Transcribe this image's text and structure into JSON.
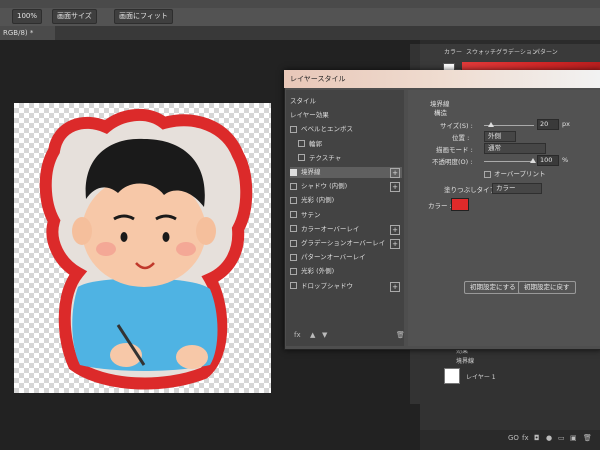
{
  "options_bar": {
    "zoom": "100%",
    "fit_screen": "画面サイズ",
    "fit_view": "画面にフィット"
  },
  "document": {
    "tab_title": "RGB/8) *"
  },
  "right_panel": {
    "tabs": [
      "カラー",
      "スウォッチ",
      "グラデーション",
      "パターン"
    ]
  },
  "dialog": {
    "title": "レイヤースタイル",
    "styles": [
      {
        "label": "スタイル",
        "checkbox": false,
        "checked": false,
        "plus": false,
        "active": false,
        "indent": false
      },
      {
        "label": "レイヤー効果",
        "checkbox": false,
        "checked": false,
        "plus": false,
        "active": false,
        "indent": false
      },
      {
        "label": "ベベルとエンボス",
        "checkbox": true,
        "checked": false,
        "plus": false,
        "active": false,
        "indent": false
      },
      {
        "label": "輪郭",
        "checkbox": true,
        "checked": false,
        "plus": false,
        "active": false,
        "indent": true
      },
      {
        "label": "テクスチャ",
        "checkbox": true,
        "checked": false,
        "plus": false,
        "active": false,
        "indent": true
      },
      {
        "label": "境界線",
        "checkbox": true,
        "checked": true,
        "plus": true,
        "active": true,
        "indent": false
      },
      {
        "label": "シャドウ (内側)",
        "checkbox": true,
        "checked": false,
        "plus": true,
        "active": false,
        "indent": false
      },
      {
        "label": "光彩 (内側)",
        "checkbox": true,
        "checked": false,
        "plus": false,
        "active": false,
        "indent": false
      },
      {
        "label": "サテン",
        "checkbox": true,
        "checked": false,
        "plus": false,
        "active": false,
        "indent": false
      },
      {
        "label": "カラーオーバーレイ",
        "checkbox": true,
        "checked": false,
        "plus": true,
        "active": false,
        "indent": false
      },
      {
        "label": "グラデーションオーバーレイ",
        "checkbox": true,
        "checked": false,
        "plus": true,
        "active": false,
        "indent": false
      },
      {
        "label": "パターンオーバーレイ",
        "checkbox": true,
        "checked": false,
        "plus": false,
        "active": false,
        "indent": false
      },
      {
        "label": "光彩 (外側)",
        "checkbox": true,
        "checked": false,
        "plus": false,
        "active": false,
        "indent": false
      },
      {
        "label": "ドロップシャドウ",
        "checkbox": true,
        "checked": false,
        "plus": true,
        "active": false,
        "indent": false
      }
    ],
    "stroke": {
      "heading": "境界線",
      "subheading": "構造",
      "size_label": "サイズ(S) :",
      "size_value": "20",
      "size_unit": "px",
      "position_label": "位置 :",
      "position_value": "外側",
      "blend_label": "描画モード :",
      "blend_value": "通常",
      "opacity_label": "不透明度(O) :",
      "opacity_value": "100",
      "opacity_unit": "%",
      "overprint_label": "オーバープリント",
      "fill_type_label": "塗りつぶしタイプ :",
      "fill_type_value": "カラー",
      "color_label": "カラー :",
      "color_value": "#e02a2a"
    },
    "buttons": {
      "make_default": "初期設定にする",
      "reset_default": "初期設定に戻す"
    },
    "fx_label": "fx"
  },
  "layers": {
    "items": [
      "効果",
      "境界線",
      "レイヤー 1"
    ],
    "footer_icons": [
      "GO",
      "fx",
      "◘",
      "●",
      "▭",
      "▣",
      "🗑"
    ]
  },
  "colors": {
    "accent_red": "#e02a2a",
    "dialog_bg": "#4e4e4e",
    "app_bg": "#1d1d1d"
  }
}
